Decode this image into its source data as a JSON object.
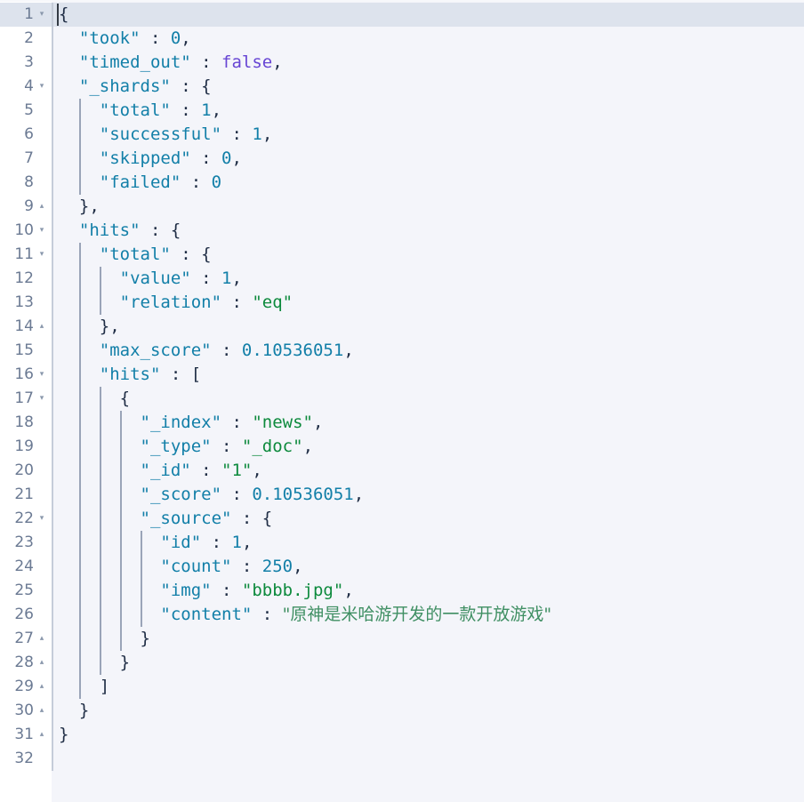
{
  "editor": {
    "name": "json-response-viewer",
    "language": "json",
    "active_line": 1,
    "total_lines": 32,
    "colors": {
      "background": "#f4f5fa",
      "gutter_background": "#ffffff",
      "active_line": "#dde3ed",
      "line_number": "#6b7a93",
      "key": "#127fa8",
      "string": "#0d8a3d",
      "number": "#127fa8",
      "boolean": "#6745d4",
      "punctuation": "#1f2d45",
      "indent_guide": "#9aa4b8",
      "cjk_string": "#3f8f63"
    },
    "fold_markers": {
      "open": "▾",
      "close": "▴"
    },
    "lines": [
      {
        "no": "1",
        "fold": "▾",
        "indent": 0,
        "guides": 0,
        "tokens": [
          {
            "t": "{",
            "c": "p"
          }
        ]
      },
      {
        "no": "2",
        "fold": "",
        "indent": 1,
        "guides": 0,
        "tokens": [
          {
            "t": "\"took\"",
            "c": "k"
          },
          {
            "t": " : ",
            "c": "p"
          },
          {
            "t": "0",
            "c": "n"
          },
          {
            "t": ",",
            "c": "p"
          }
        ]
      },
      {
        "no": "3",
        "fold": "",
        "indent": 1,
        "guides": 0,
        "tokens": [
          {
            "t": "\"timed_out\"",
            "c": "k"
          },
          {
            "t": " : ",
            "c": "p"
          },
          {
            "t": "false",
            "c": "b"
          },
          {
            "t": ",",
            "c": "p"
          }
        ]
      },
      {
        "no": "4",
        "fold": "▾",
        "indent": 1,
        "guides": 0,
        "tokens": [
          {
            "t": "\"_shards\"",
            "c": "k"
          },
          {
            "t": " : ",
            "c": "p"
          },
          {
            "t": "{",
            "c": "p"
          }
        ]
      },
      {
        "no": "5",
        "fold": "",
        "indent": 2,
        "guides": 1,
        "tokens": [
          {
            "t": "\"total\"",
            "c": "k"
          },
          {
            "t": " : ",
            "c": "p"
          },
          {
            "t": "1",
            "c": "n"
          },
          {
            "t": ",",
            "c": "p"
          }
        ]
      },
      {
        "no": "6",
        "fold": "",
        "indent": 2,
        "guides": 1,
        "tokens": [
          {
            "t": "\"successful\"",
            "c": "k"
          },
          {
            "t": " : ",
            "c": "p"
          },
          {
            "t": "1",
            "c": "n"
          },
          {
            "t": ",",
            "c": "p"
          }
        ]
      },
      {
        "no": "7",
        "fold": "",
        "indent": 2,
        "guides": 1,
        "tokens": [
          {
            "t": "\"skipped\"",
            "c": "k"
          },
          {
            "t": " : ",
            "c": "p"
          },
          {
            "t": "0",
            "c": "n"
          },
          {
            "t": ",",
            "c": "p"
          }
        ]
      },
      {
        "no": "8",
        "fold": "",
        "indent": 2,
        "guides": 1,
        "tokens": [
          {
            "t": "\"failed\"",
            "c": "k"
          },
          {
            "t": " : ",
            "c": "p"
          },
          {
            "t": "0",
            "c": "n"
          }
        ]
      },
      {
        "no": "9",
        "fold": "▴",
        "indent": 1,
        "guides": 0,
        "tokens": [
          {
            "t": "},",
            "c": "p"
          }
        ]
      },
      {
        "no": "10",
        "fold": "▾",
        "indent": 1,
        "guides": 0,
        "tokens": [
          {
            "t": "\"hits\"",
            "c": "k"
          },
          {
            "t": " : ",
            "c": "p"
          },
          {
            "t": "{",
            "c": "p"
          }
        ]
      },
      {
        "no": "11",
        "fold": "▾",
        "indent": 2,
        "guides": 1,
        "tokens": [
          {
            "t": "\"total\"",
            "c": "k"
          },
          {
            "t": " : ",
            "c": "p"
          },
          {
            "t": "{",
            "c": "p"
          }
        ]
      },
      {
        "no": "12",
        "fold": "",
        "indent": 3,
        "guides": 2,
        "tokens": [
          {
            "t": "\"value\"",
            "c": "k"
          },
          {
            "t": " : ",
            "c": "p"
          },
          {
            "t": "1",
            "c": "n"
          },
          {
            "t": ",",
            "c": "p"
          }
        ]
      },
      {
        "no": "13",
        "fold": "",
        "indent": 3,
        "guides": 2,
        "tokens": [
          {
            "t": "\"relation\"",
            "c": "k"
          },
          {
            "t": " : ",
            "c": "p"
          },
          {
            "t": "\"eq\"",
            "c": "s"
          }
        ]
      },
      {
        "no": "14",
        "fold": "▴",
        "indent": 2,
        "guides": 1,
        "tokens": [
          {
            "t": "},",
            "c": "p"
          }
        ]
      },
      {
        "no": "15",
        "fold": "",
        "indent": 2,
        "guides": 1,
        "tokens": [
          {
            "t": "\"max_score\"",
            "c": "k"
          },
          {
            "t": " : ",
            "c": "p"
          },
          {
            "t": "0.10536051",
            "c": "n"
          },
          {
            "t": ",",
            "c": "p"
          }
        ]
      },
      {
        "no": "16",
        "fold": "▾",
        "indent": 2,
        "guides": 1,
        "tokens": [
          {
            "t": "\"hits\"",
            "c": "k"
          },
          {
            "t": " : ",
            "c": "p"
          },
          {
            "t": "[",
            "c": "p"
          }
        ]
      },
      {
        "no": "17",
        "fold": "▾",
        "indent": 3,
        "guides": 2,
        "tokens": [
          {
            "t": "{",
            "c": "p"
          }
        ]
      },
      {
        "no": "18",
        "fold": "",
        "indent": 4,
        "guides": 3,
        "tokens": [
          {
            "t": "\"_index\"",
            "c": "k"
          },
          {
            "t": " : ",
            "c": "p"
          },
          {
            "t": "\"news\"",
            "c": "s"
          },
          {
            "t": ",",
            "c": "p"
          }
        ]
      },
      {
        "no": "19",
        "fold": "",
        "indent": 4,
        "guides": 3,
        "tokens": [
          {
            "t": "\"_type\"",
            "c": "k"
          },
          {
            "t": " : ",
            "c": "p"
          },
          {
            "t": "\"_doc\"",
            "c": "s"
          },
          {
            "t": ",",
            "c": "p"
          }
        ]
      },
      {
        "no": "20",
        "fold": "",
        "indent": 4,
        "guides": 3,
        "tokens": [
          {
            "t": "\"_id\"",
            "c": "k"
          },
          {
            "t": " : ",
            "c": "p"
          },
          {
            "t": "\"1\"",
            "c": "s"
          },
          {
            "t": ",",
            "c": "p"
          }
        ]
      },
      {
        "no": "21",
        "fold": "",
        "indent": 4,
        "guides": 3,
        "tokens": [
          {
            "t": "\"_score\"",
            "c": "k"
          },
          {
            "t": " : ",
            "c": "p"
          },
          {
            "t": "0.10536051",
            "c": "n"
          },
          {
            "t": ",",
            "c": "p"
          }
        ]
      },
      {
        "no": "22",
        "fold": "▾",
        "indent": 4,
        "guides": 3,
        "tokens": [
          {
            "t": "\"_source\"",
            "c": "k"
          },
          {
            "t": " : ",
            "c": "p"
          },
          {
            "t": "{",
            "c": "p"
          }
        ]
      },
      {
        "no": "23",
        "fold": "",
        "indent": 5,
        "guides": 4,
        "tokens": [
          {
            "t": "\"id\"",
            "c": "k"
          },
          {
            "t": " : ",
            "c": "p"
          },
          {
            "t": "1",
            "c": "n"
          },
          {
            "t": ",",
            "c": "p"
          }
        ]
      },
      {
        "no": "24",
        "fold": "",
        "indent": 5,
        "guides": 4,
        "tokens": [
          {
            "t": "\"count\"",
            "c": "k"
          },
          {
            "t": " : ",
            "c": "p"
          },
          {
            "t": "250",
            "c": "n"
          },
          {
            "t": ",",
            "c": "p"
          }
        ]
      },
      {
        "no": "25",
        "fold": "",
        "indent": 5,
        "guides": 4,
        "tokens": [
          {
            "t": "\"img\"",
            "c": "k"
          },
          {
            "t": " : ",
            "c": "p"
          },
          {
            "t": "\"bbbb.jpg\"",
            "c": "s"
          },
          {
            "t": ",",
            "c": "p"
          }
        ]
      },
      {
        "no": "26",
        "fold": "",
        "indent": 5,
        "guides": 4,
        "tokens": [
          {
            "t": "\"content\"",
            "c": "k"
          },
          {
            "t": " : ",
            "c": "p"
          },
          {
            "t": "\"原神是米哈游开发的一款开放游戏\"",
            "c": "cjk"
          }
        ]
      },
      {
        "no": "27",
        "fold": "▴",
        "indent": 4,
        "guides": 3,
        "tokens": [
          {
            "t": "}",
            "c": "p"
          }
        ]
      },
      {
        "no": "28",
        "fold": "▴",
        "indent": 3,
        "guides": 2,
        "tokens": [
          {
            "t": "}",
            "c": "p"
          }
        ]
      },
      {
        "no": "29",
        "fold": "▴",
        "indent": 2,
        "guides": 1,
        "tokens": [
          {
            "t": "]",
            "c": "p"
          }
        ]
      },
      {
        "no": "30",
        "fold": "▴",
        "indent": 1,
        "guides": 0,
        "tokens": [
          {
            "t": "}",
            "c": "p"
          }
        ]
      },
      {
        "no": "31",
        "fold": "▴",
        "indent": 0,
        "guides": 0,
        "tokens": [
          {
            "t": "}",
            "c": "p"
          }
        ]
      },
      {
        "no": "32",
        "fold": "",
        "indent": 0,
        "guides": 0,
        "tokens": []
      }
    ]
  }
}
